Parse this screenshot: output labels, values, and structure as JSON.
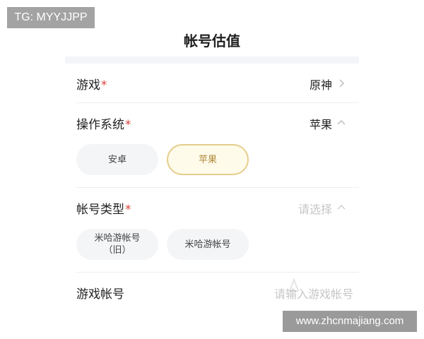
{
  "watermark_top_left": "TG: MYYJJPP",
  "watermark_bottom_right": "www.zhcnmajiang.com",
  "page_title": "帐号估值",
  "required_mark": "*",
  "fields": {
    "game": {
      "label": "游戏",
      "value": "原神",
      "chevron": "chevron-right-icon"
    },
    "os": {
      "label": "操作系统",
      "value": "苹果",
      "chevron": "chevron-up-icon",
      "options": [
        {
          "label": "安卓",
          "selected": false
        },
        {
          "label": "苹果",
          "selected": true
        }
      ]
    },
    "account_type": {
      "label": "帐号类型",
      "placeholder": "请选择",
      "chevron": "chevron-up-icon",
      "options": [
        {
          "label": "米哈游帐号（旧）",
          "selected": false
        },
        {
          "label": "米哈游帐号",
          "selected": false
        }
      ]
    },
    "game_account": {
      "label": "游戏帐号",
      "placeholder": "请输入游戏帐号"
    }
  },
  "colors": {
    "required": "#d8453d",
    "selected_border": "#e5cd8c",
    "selected_text": "#b08a3a",
    "option_bg": "#f4f5f7"
  }
}
